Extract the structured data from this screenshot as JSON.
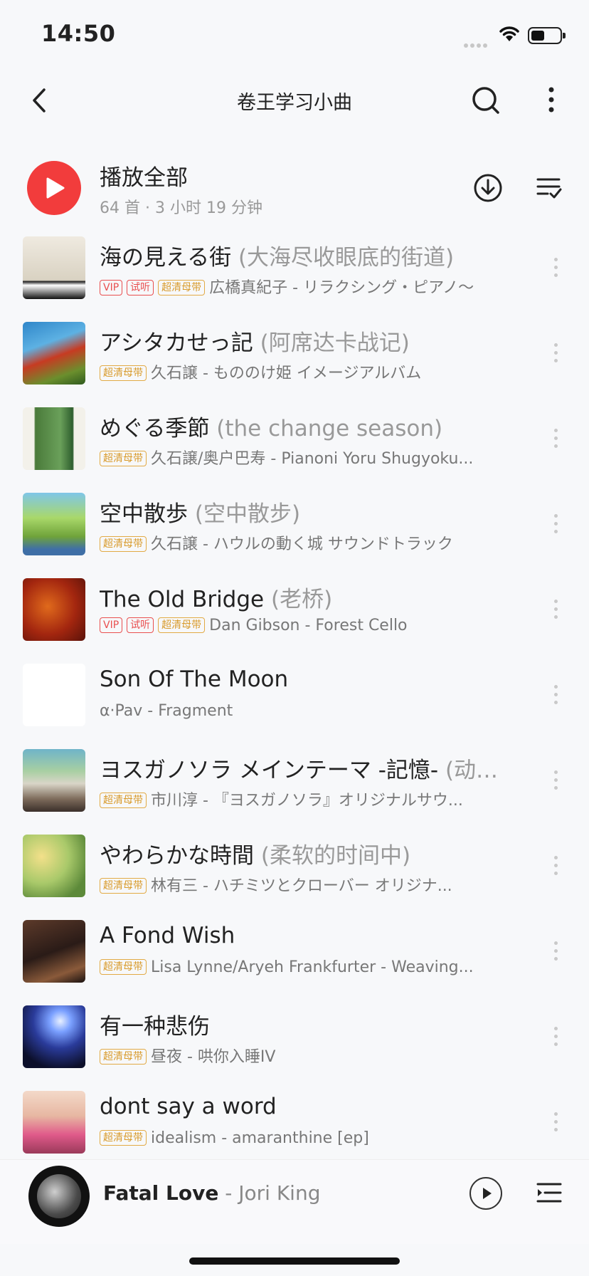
{
  "status": {
    "time": "14:50"
  },
  "header": {
    "title": "卷王学习小曲"
  },
  "play_all": {
    "label": "播放全部",
    "summary": "64 首 · 3 小时 19 分钟"
  },
  "tags": {
    "vip": "VIP",
    "try": "试听",
    "hq": "超清母带"
  },
  "songs": [
    {
      "title": "海の見える街",
      "alias": "(大海尽收眼底的街道)",
      "vip": true,
      "trial": true,
      "hq": true,
      "meta": "広橋真紀子 - リラクシング・ピアノ～"
    },
    {
      "title": "アシタカせっ記",
      "alias": "(阿席达卡战记)",
      "vip": false,
      "trial": false,
      "hq": true,
      "meta": "久石譲 - もののけ姫 イメージアルバム"
    },
    {
      "title": "めぐる季節",
      "alias": "(the change season)",
      "vip": false,
      "trial": false,
      "hq": true,
      "meta": "久石譲/奥户巴寿 - Pianoni Yoru Shugyoku..."
    },
    {
      "title": "空中散歩",
      "alias": "(空中散步)",
      "vip": false,
      "trial": false,
      "hq": true,
      "meta": "久石譲 - ハウルの動く城 サウンドトラック"
    },
    {
      "title": "The Old Bridge",
      "alias": "(老桥)",
      "vip": true,
      "trial": true,
      "hq": true,
      "meta": "Dan Gibson - Forest Cello"
    },
    {
      "title": "Son Of The Moon",
      "alias": "",
      "vip": false,
      "trial": false,
      "hq": false,
      "meta": "α·Pav - Fragment"
    },
    {
      "title": "ヨスガノソラ メインテーマ -記憶-",
      "alias": "(动…",
      "vip": false,
      "trial": false,
      "hq": true,
      "meta": "市川淳 - 『ヨスガノソラ』オリジナルサウ..."
    },
    {
      "title": "やわらかな時間",
      "alias": "(柔软的时间中)",
      "vip": false,
      "trial": false,
      "hq": true,
      "meta": "林有三 - ハチミツとクローバー オリジナ..."
    },
    {
      "title": "A Fond Wish",
      "alias": "",
      "vip": false,
      "trial": false,
      "hq": true,
      "meta": "Lisa Lynne/Aryeh Frankfurter - Weaving..."
    },
    {
      "title": "有一种悲伤",
      "alias": "",
      "vip": false,
      "trial": false,
      "hq": true,
      "meta": "昼夜 - 哄你入睡IV"
    },
    {
      "title": "dont say a word",
      "alias": "",
      "vip": false,
      "trial": false,
      "hq": true,
      "meta": "idealism - amaranthine [ep]"
    }
  ],
  "covers": [
    {
      "name": "cover-sea-town",
      "bg": "linear-gradient(180deg,#efeae0 0%,#d9d2c2 70%,#222 72%,#fff 78%,#111 100%)"
    },
    {
      "name": "cover-ashitaka",
      "bg": "linear-gradient(160deg,#2f86c9 0%,#5db1e3 35%,#c73b22 55%,#6b8f2d 80%,#2f5a1e 100%)"
    },
    {
      "name": "cover-change-season",
      "bg": "linear-gradient(90deg,#f3f1ea 0%,#f3f1ea 18%,#4a7a3a 20%,#6aa05a 60%,#2d5d2d 80%,#f3f1ea 82%)"
    },
    {
      "name": "cover-sky-walk",
      "bg": "linear-gradient(180deg,#7fc6e8 0%,#a9d86a 40%,#6fa33a 70%,#3f6fa6 90%)"
    },
    {
      "name": "cover-old-bridge",
      "bg": "radial-gradient(circle at 40% 45%,#e06a1c 0%,#a3260f 55%,#5a120a 100%)"
    },
    {
      "name": "cover-fragment",
      "bg": "#ffffff"
    },
    {
      "name": "cover-yosuga",
      "bg": "linear-gradient(180deg,#6fb4c9 0%,#a8cfa2 35%,#d9d5c8 55%,#7c6a5a 80%,#3a2f2a 100%)"
    },
    {
      "name": "cover-honey-clover",
      "bg": "radial-gradient(circle at 30% 35%,#f3e08a 0%,#a9c96a 45%,#5d8a3a 80%)"
    },
    {
      "name": "cover-fond-wish",
      "bg": "linear-gradient(160deg,#5c3a2a 0%,#2a1b17 50%,#8a5a3a 80%,#1a1210 100%)"
    },
    {
      "name": "cover-sadness",
      "bg": "radial-gradient(circle at 60% 25%,#e8f0ff 0%,#7aa0ff 18%,#2a3b9a 45%,#0c0f2a 80%)"
    },
    {
      "name": "cover-dont-say",
      "bg": "linear-gradient(180deg,#f3d9c9 0%,#e7b7a2 40%,#e05a8a 70%,#9a3a5a 100%)"
    }
  ],
  "mini_player": {
    "title": "Fatal Love",
    "separator": " - ",
    "artist": "Jori King"
  },
  "colors": {
    "accent": "#f23c3c",
    "hq_tag": "#d89a2a",
    "vip_tag": "#e94f4f"
  },
  "icons": [
    "back-icon",
    "search-icon",
    "more-vertical-icon",
    "play-icon",
    "download-icon",
    "multi-select-icon",
    "song-more-icon",
    "play-circle-icon",
    "playlist-queue-icon"
  ]
}
